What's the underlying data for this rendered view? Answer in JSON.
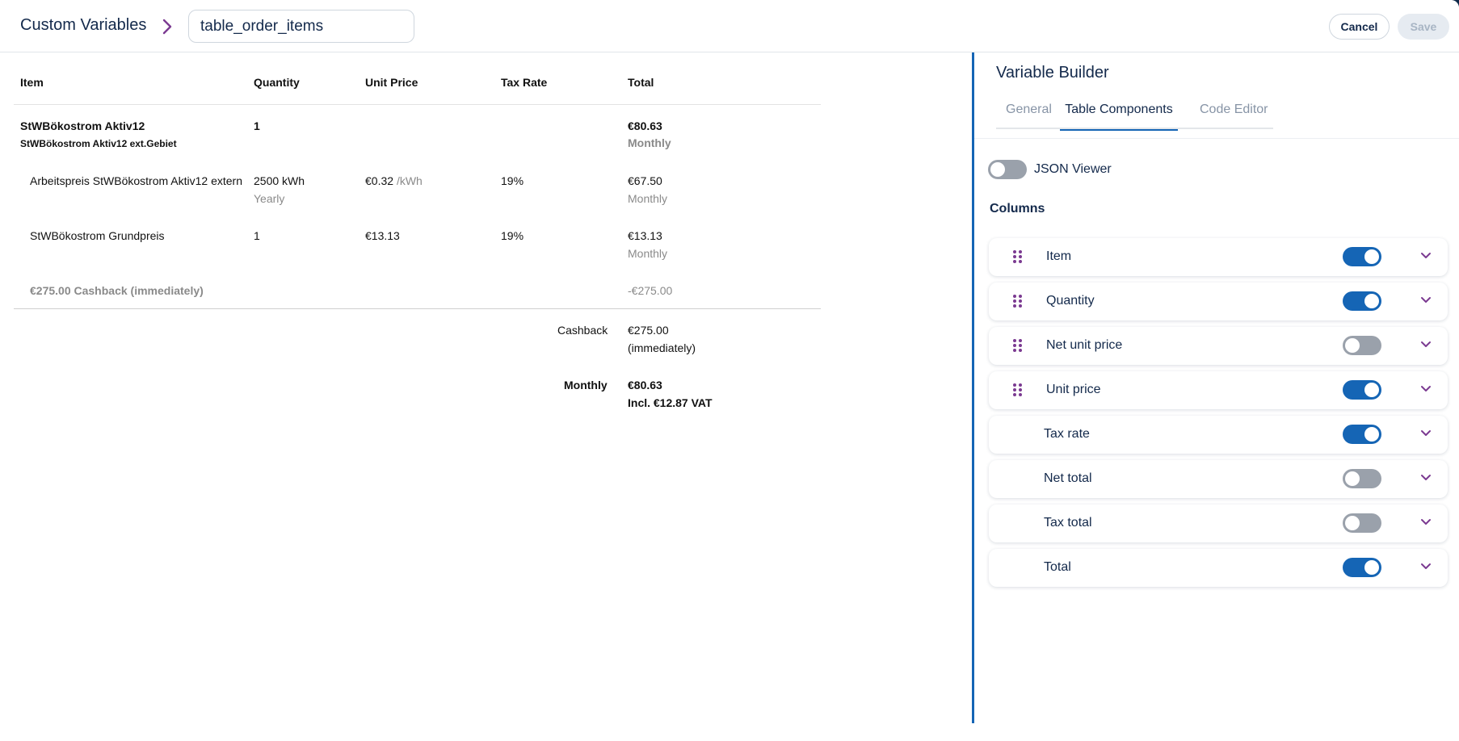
{
  "header": {
    "breadcrumb": "Custom Variables",
    "variable_name": "table_order_items",
    "cancel_label": "Cancel",
    "save_label": "Save"
  },
  "table": {
    "columns": [
      "Item",
      "Quantity",
      "Unit Price",
      "Tax Rate",
      "Total"
    ],
    "product": {
      "name": "StWBökostrom Aktiv12",
      "subtitle": "StWBökostrom Aktiv12 ext.Gebiet",
      "quantity": "1",
      "total": "€80.63",
      "period": "Monthly"
    },
    "lines": [
      {
        "item": "Arbeitspreis StWBökostrom Aktiv12 extern",
        "quantity": "2500 kWh",
        "quantity_period": "Yearly",
        "unit_price": "€0.32",
        "unit_suffix": "/kWh",
        "tax_rate": "19%",
        "total": "€67.50",
        "total_period": "Monthly"
      },
      {
        "item": "StWBökostrom Grundpreis",
        "quantity": "1",
        "unit_price": "€13.13",
        "tax_rate": "19%",
        "total": "€13.13",
        "total_period": "Monthly"
      }
    ],
    "cashback_line": {
      "label": "€275.00 Cashback (immediately)",
      "total": "-€275.00"
    },
    "summary": {
      "cashback_label": "Cashback",
      "cashback_value": "€275.00",
      "cashback_note": "(immediately)",
      "monthly_label": "Monthly",
      "monthly_value": "€80.63",
      "monthly_vat": "Incl. €12.87 VAT"
    }
  },
  "builder": {
    "title": "Variable Builder",
    "tabs": [
      {
        "label": "General",
        "active": false
      },
      {
        "label": "Table Components",
        "active": true
      },
      {
        "label": "Code Editor",
        "active": false
      }
    ],
    "json_viewer": {
      "label": "JSON Viewer",
      "enabled": false
    },
    "columns_title": "Columns",
    "columns": [
      {
        "label": "Item",
        "enabled": true,
        "draggable": true
      },
      {
        "label": "Quantity",
        "enabled": true,
        "draggable": true
      },
      {
        "label": "Net unit price",
        "enabled": false,
        "draggable": true
      },
      {
        "label": "Unit price",
        "enabled": true,
        "draggable": true
      },
      {
        "label": "Tax rate",
        "enabled": true,
        "draggable": false
      },
      {
        "label": "Net total",
        "enabled": false,
        "draggable": false
      },
      {
        "label": "Tax total",
        "enabled": false,
        "draggable": false
      },
      {
        "label": "Total",
        "enabled": true,
        "draggable": false
      }
    ],
    "icons": {
      "drag": "drag-handle-icon",
      "expand": "chevron-down-icon",
      "breadcrumb": "chevron-right-icon"
    },
    "colors": {
      "accent": "#1565b5",
      "toggle_off": "#9aa1ab",
      "icon_purple": "#7b3a91",
      "text_primary": "#13294b"
    }
  }
}
